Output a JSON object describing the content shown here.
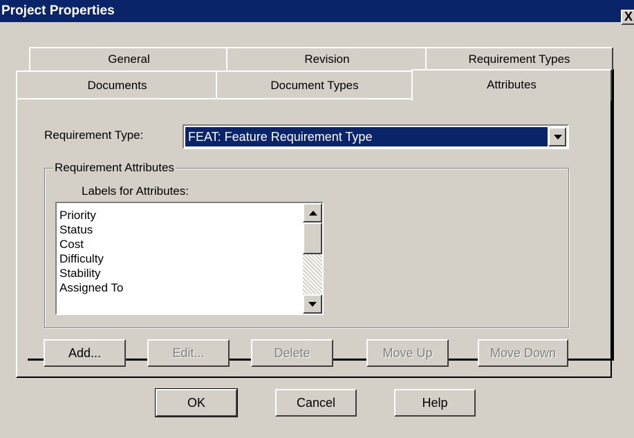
{
  "window": {
    "title": "Project Properties",
    "close_label": "X"
  },
  "tabs_back": [
    {
      "label": "General"
    },
    {
      "label": "Revision"
    },
    {
      "label": "Requirement Types"
    }
  ],
  "tabs_front": [
    {
      "label": "Documents"
    },
    {
      "label": "Document Types"
    },
    {
      "label": "Attributes",
      "selected": true
    }
  ],
  "form": {
    "requirement_type_label": "Requirement Type:",
    "requirement_type_value": "FEAT: Feature Requirement Type"
  },
  "group": {
    "legend": "Requirement Attributes",
    "list_label": "Labels for Attributes:",
    "items": [
      "Priority",
      "Status",
      "Cost",
      "Difficulty",
      "Stability",
      "Assigned To"
    ]
  },
  "buttons": {
    "add": "Add...",
    "edit": "Edit...",
    "delete": "Delete",
    "move_up": "Move Up",
    "move_down": "Move Down"
  },
  "dialog_buttons": {
    "ok": "OK",
    "cancel": "Cancel",
    "help": "Help"
  },
  "colors": {
    "titlebar": "#0a246a",
    "face": "#d4d0c8",
    "selection": "#0a246a"
  }
}
